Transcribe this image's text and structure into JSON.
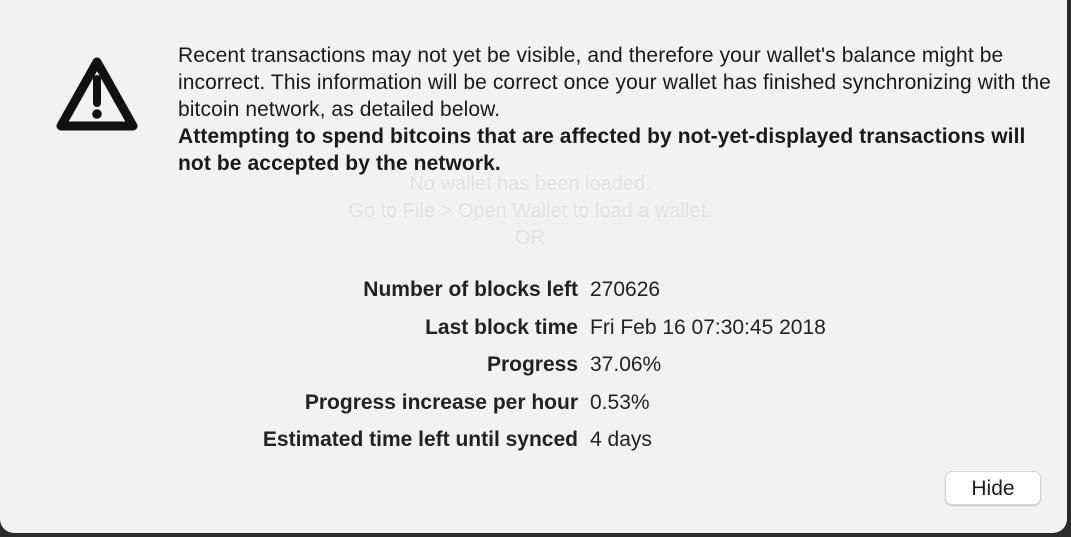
{
  "background_dialog": {
    "line1": "No wallet has been loaded.",
    "line2": "Go to File > Open Wallet to load a wallet.",
    "line3": "OR"
  },
  "icon": {
    "name": "warning-triangle-icon"
  },
  "message": {
    "normal": "Recent transactions may not yet be visible, and therefore your wallet's balance might be incorrect. This information will be correct once your wallet has finished synchronizing with the bitcoin network, as detailed below.",
    "bold": "Attempting to spend bitcoins that are affected by not-yet-displayed transactions will not be accepted by the network."
  },
  "stats": [
    {
      "label": "Number of blocks left",
      "value": "270626"
    },
    {
      "label": "Last block time",
      "value": "Fri Feb 16 07:30:45 2018"
    },
    {
      "label": "Progress",
      "value": "37.06%"
    },
    {
      "label": "Progress increase per hour",
      "value": "0.53%"
    },
    {
      "label": "Estimated time left until synced",
      "value": "4 days"
    }
  ],
  "buttons": {
    "hide": "Hide"
  },
  "colors": {
    "overlay_bg": "#f2f2f2",
    "text": "#1a1a1a",
    "ghost_text": "#e3e3e3",
    "window_edge": "#2b2b2b"
  }
}
